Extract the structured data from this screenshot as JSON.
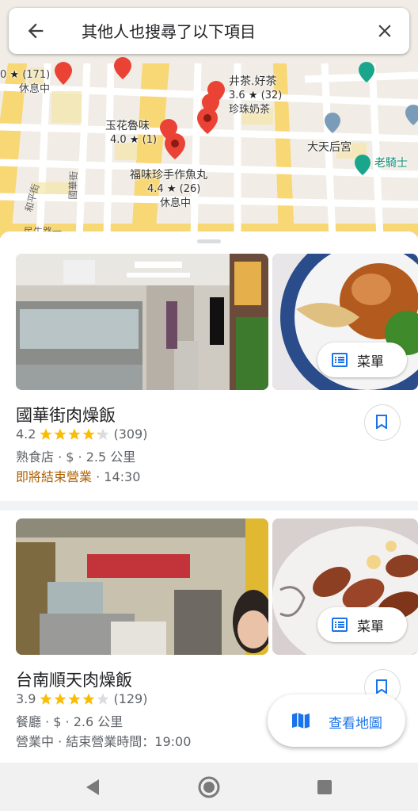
{
  "header": {
    "title": "其他人也搜尋了以下項目"
  },
  "map": {
    "labels": [
      {
        "name": "",
        "rating": "0",
        "reviews": "(171)",
        "status": "休息中"
      },
      {
        "name": "井茶.好茶",
        "rating": "3.6",
        "reviews": "(32)",
        "status": "珍珠奶茶"
      },
      {
        "name": "玉花魯味",
        "rating": "4.0",
        "reviews": "(1)",
        "status": ""
      },
      {
        "name": "福味珍手作魚丸",
        "rating": "4.4",
        "reviews": "(26)",
        "status": "休息中"
      },
      {
        "name": "大天后宮",
        "rating": "",
        "reviews": "",
        "status": ""
      },
      {
        "name": "老騎士",
        "rating": "",
        "reviews": "",
        "status": ""
      }
    ],
    "streets": [
      "和平街",
      "國華街",
      "民生路一"
    ],
    "star_glyph": "★"
  },
  "results": [
    {
      "name": "國華街肉燥飯",
      "rating": "4.2",
      "stars": 4.2,
      "reviews": "(309)",
      "meta": "熟食店 · $ · 2.5 公里",
      "status_open": "即將結束營業",
      "status_time": " · 14:30",
      "status_color": "#b06000",
      "menu_label": "菜單"
    },
    {
      "name": "台南順天肉燥飯",
      "rating": "3.9",
      "stars": 3.9,
      "reviews": "(129)",
      "meta": "餐廳 · $ · 2.6 公里",
      "status_open": "營業中",
      "status_time": " · 結束營業時間：19:00",
      "status_color": "#5f6368",
      "menu_label": "菜單"
    }
  ],
  "fab": {
    "label": "查看地圖",
    "icon": "map-icon"
  },
  "colors": {
    "accent": "#1a73e8",
    "star": "#fbbc04",
    "pin": "#ea4335"
  }
}
